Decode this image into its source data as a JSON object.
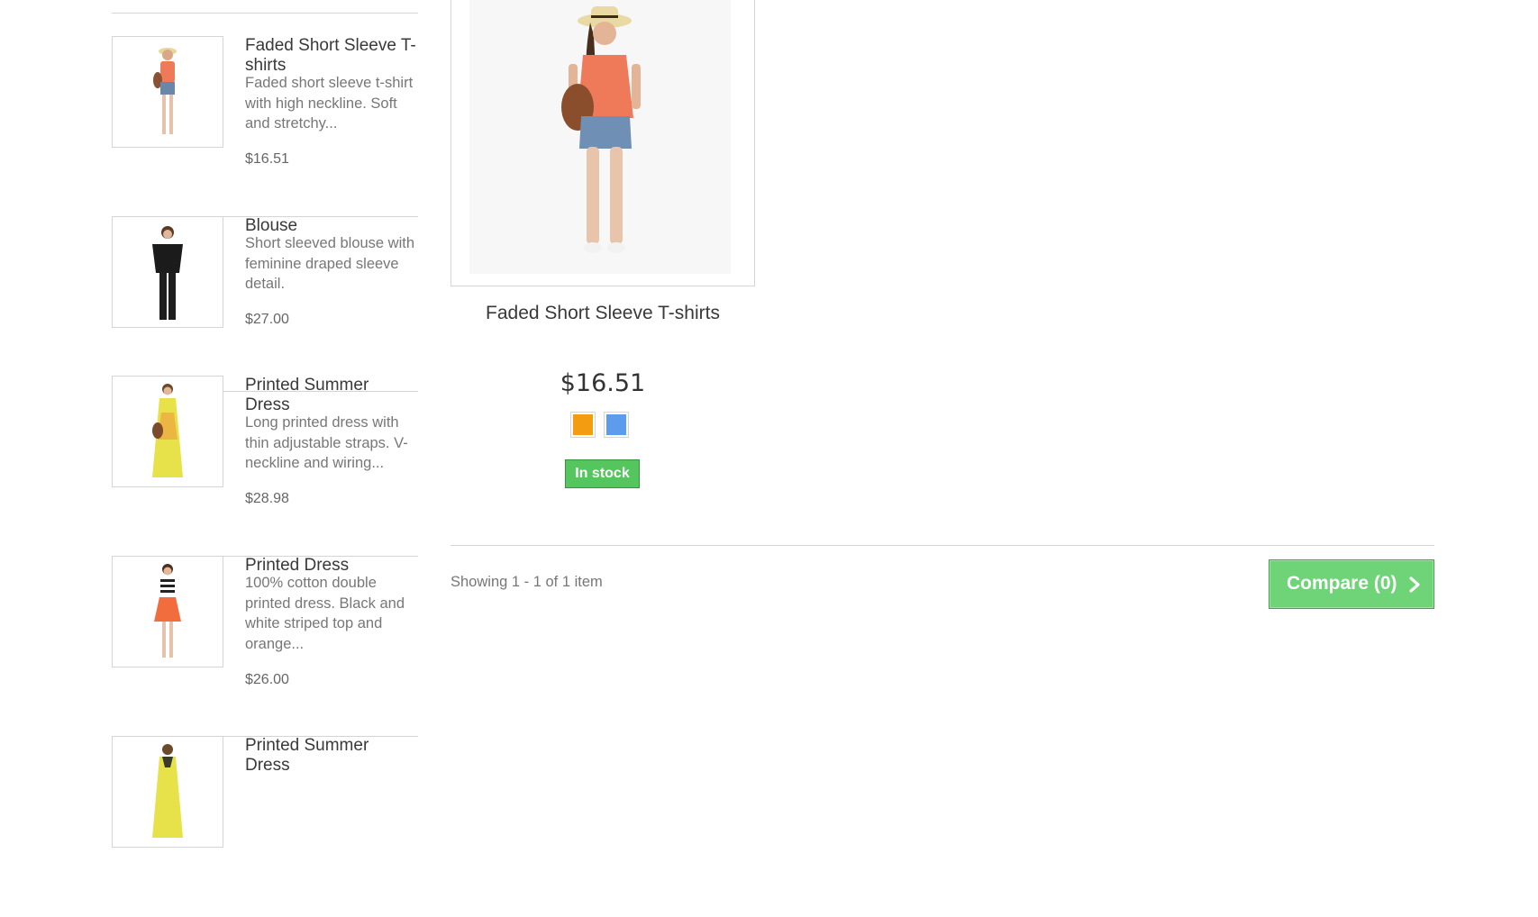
{
  "sidebar": {
    "items": [
      {
        "name": "Faded Short Sleeve T-shirts",
        "desc": "Faded short sleeve t-shirt with high neckline. Soft and stretchy...",
        "price": "$16.51"
      },
      {
        "name": "Blouse",
        "desc": "Short sleeved blouse with feminine draped sleeve detail.",
        "price": "$27.00"
      },
      {
        "name": "Printed Summer Dress",
        "desc": "Long printed dress with thin adjustable straps. V-neckline and wiring...",
        "price": "$28.98"
      },
      {
        "name": "Printed Dress",
        "desc": "100% cotton double printed dress. Black and white striped top and orange...",
        "price": "$26.00"
      },
      {
        "name": "Printed Summer Dress"
      }
    ]
  },
  "product": {
    "name": "Faded Short Sleeve T-shirts",
    "price": "$16.51",
    "colors": [
      "#f39c11",
      "#5d9cec"
    ],
    "availability": "In stock"
  },
  "footer": {
    "showing": "Showing 1 - 1 of 1 item",
    "compare_label": "Compare (0)",
    "compare_icon": "chevron-right-icon"
  },
  "colors": {
    "stock_green": "#55c65e",
    "compare_green": "#6fd477",
    "border": "#d6d4d4"
  }
}
